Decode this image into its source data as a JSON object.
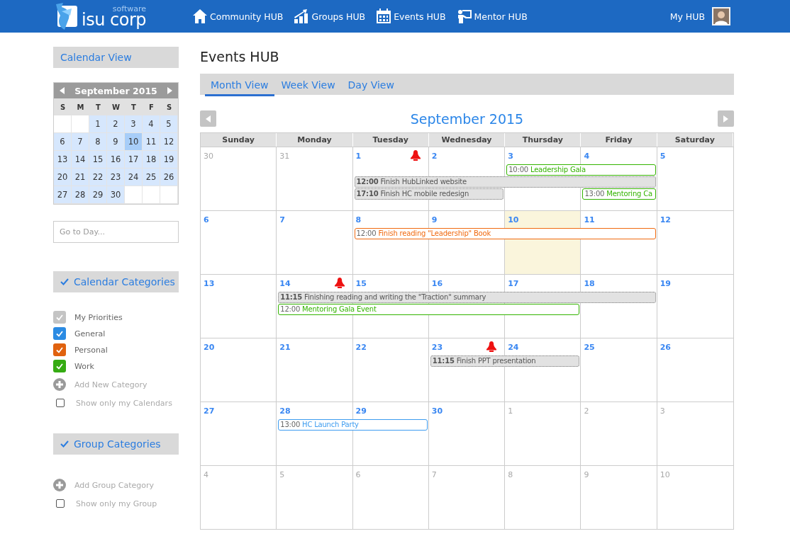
{
  "header": {
    "logo_small": "software",
    "logo_text": "isu corp",
    "nav": [
      {
        "label": "Community HUB"
      },
      {
        "label": "Groups HUB"
      },
      {
        "label": "Events HUB"
      },
      {
        "label": "Mentor HUB"
      }
    ],
    "user": "My HUB"
  },
  "sidebar": {
    "view_title": "Calendar View",
    "mini_calendar": {
      "title": "September 2015",
      "weekdays": [
        "S",
        "M",
        "T",
        "W",
        "T",
        "F",
        "S"
      ],
      "weeks": [
        [
          {
            "label": "1",
            "selected": false
          },
          {
            "label": "2",
            "selected": false
          },
          {
            "label": "3",
            "selected": false
          },
          {
            "label": "4",
            "selected": false
          },
          {
            "label": "5",
            "selected": false
          }
        ],
        [
          {
            "label": "6",
            "selected": false
          },
          {
            "label": "7",
            "selected": false
          },
          {
            "label": "8",
            "selected": false
          },
          {
            "label": "9",
            "selected": false
          },
          {
            "label": "10",
            "selected": true
          },
          {
            "label": "11",
            "selected": false
          },
          {
            "label": "12",
            "selected": false
          }
        ],
        [
          {
            "label": "13",
            "selected": false
          },
          {
            "label": "14",
            "selected": false
          },
          {
            "label": "15",
            "selected": false
          },
          {
            "label": "16",
            "selected": false
          },
          {
            "label": "17",
            "selected": false
          },
          {
            "label": "18",
            "selected": false
          },
          {
            "label": "19",
            "selected": false
          }
        ],
        [
          {
            "label": "20",
            "selected": false
          },
          {
            "label": "21",
            "selected": false
          },
          {
            "label": "22",
            "selected": false
          },
          {
            "label": "23",
            "selected": false
          },
          {
            "label": "24",
            "selected": false
          },
          {
            "label": "25",
            "selected": false
          },
          {
            "label": "26",
            "selected": false
          }
        ],
        [
          {
            "label": "27",
            "selected": false
          },
          {
            "label": "28",
            "selected": false
          },
          {
            "label": "29",
            "selected": false
          },
          {
            "label": "30",
            "selected": false
          }
        ]
      ]
    },
    "goto_placeholder": "Go to Day...",
    "calendar_categories": {
      "title": "Calendar Categories",
      "items": [
        {
          "label": "My Priorities",
          "checked": true,
          "color": "#c4c4c4"
        },
        {
          "label": "General",
          "checked": true,
          "color": "#2b8be3"
        },
        {
          "label": "Personal",
          "checked": true,
          "color": "#e0620f"
        },
        {
          "label": "Work",
          "checked": true,
          "color": "#35ab12"
        }
      ],
      "add_label": "Add New Category",
      "only_mine": {
        "label": "Show only my Calendars",
        "checked": false
      }
    },
    "group_categories": {
      "title": "Group Categories",
      "add_label": "Add Group Category",
      "only_mine": {
        "label": "Show only my Group",
        "checked": false
      }
    }
  },
  "main": {
    "title": "Events HUB",
    "tabs": [
      {
        "label": "Month View",
        "selected": true
      },
      {
        "label": "Week View",
        "selected": false
      },
      {
        "label": "Day View",
        "selected": false
      }
    ],
    "month_title": "September 2015",
    "weekdays": [
      "Sunday",
      "Monday",
      "Tuesday",
      "Wednesday",
      "Thursday",
      "Friday",
      "Saturday"
    ],
    "weeks": [
      {
        "days": [
          {
            "n": "30",
            "other_month": true,
            "today": false,
            "alarm": false
          },
          {
            "n": "31",
            "other_month": true,
            "today": false,
            "alarm": false
          },
          {
            "n": "1",
            "other_month": false,
            "today": false,
            "alarm": true
          },
          {
            "n": "2",
            "other_month": false,
            "today": false,
            "alarm": false
          },
          {
            "n": "3",
            "other_month": false,
            "today": false,
            "alarm": false
          },
          {
            "n": "4",
            "other_month": false,
            "today": false,
            "alarm": false
          },
          {
            "n": "5",
            "other_month": false,
            "today": false,
            "alarm": false
          }
        ],
        "lanes": [
          [
            {
              "kind": "empty"
            },
            {
              "kind": "empty"
            },
            {
              "kind": "empty"
            },
            {
              "kind": "empty"
            },
            {
              "kind": "event",
              "time": "10:00",
              "title": "Leadership Gala",
              "color": "#33b300"
            },
            {
              "kind": "continued"
            }
          ],
          [
            {
              "kind": "empty"
            },
            {
              "kind": "empty"
            },
            {
              "kind": "task",
              "time": "12:00",
              "title": "Finish HubLinked website"
            },
            {
              "kind": "continued"
            },
            {
              "kind": "continued"
            },
            {
              "kind": "continued"
            }
          ],
          [
            {
              "kind": "empty"
            },
            {
              "kind": "empty"
            },
            {
              "kind": "task",
              "time": "17:10",
              "title": "Finish HC mobile redesign"
            },
            {
              "kind": "continued"
            },
            {
              "kind": "empty"
            },
            {
              "kind": "event",
              "time": "13:00",
              "title": "Mentoring Ca",
              "color": "#33b300"
            }
          ]
        ]
      },
      {
        "days": [
          {
            "n": "6",
            "other_month": false,
            "today": false,
            "alarm": false
          },
          {
            "n": "7",
            "other_month": false,
            "today": false,
            "alarm": false
          },
          {
            "n": "8",
            "other_month": false,
            "today": false,
            "alarm": false
          },
          {
            "n": "9",
            "other_month": false,
            "today": false,
            "alarm": false
          },
          {
            "n": "10",
            "other_month": false,
            "today": true,
            "alarm": false
          },
          {
            "n": "11",
            "other_month": false,
            "today": false,
            "alarm": false
          },
          {
            "n": "12",
            "other_month": false,
            "today": false,
            "alarm": false
          }
        ],
        "lanes": [
          [
            {
              "kind": "empty"
            },
            {
              "kind": "empty"
            },
            {
              "kind": "event",
              "time": "12:00",
              "title": "Finish reading \"Leadership\" Book",
              "color": "#f06a10"
            },
            {
              "kind": "continued"
            },
            {
              "kind": "continued"
            },
            {
              "kind": "continued"
            }
          ]
        ]
      },
      {
        "days": [
          {
            "n": "13",
            "other_month": false,
            "today": false,
            "alarm": false
          },
          {
            "n": "14",
            "other_month": false,
            "today": false,
            "alarm": true
          },
          {
            "n": "15",
            "other_month": false,
            "today": false,
            "alarm": false
          },
          {
            "n": "16",
            "other_month": false,
            "today": false,
            "alarm": false
          },
          {
            "n": "17",
            "other_month": false,
            "today": false,
            "alarm": false
          },
          {
            "n": "18",
            "other_month": false,
            "today": false,
            "alarm": false
          },
          {
            "n": "19",
            "other_month": false,
            "today": false,
            "alarm": false
          }
        ],
        "lanes": [
          [
            {
              "kind": "empty"
            },
            {
              "kind": "task",
              "time": "11:15",
              "title": "Finishing reading and writing the \"Traction\" summary"
            },
            {
              "kind": "continued"
            },
            {
              "kind": "continued"
            },
            {
              "kind": "continued"
            },
            {
              "kind": "continued"
            }
          ],
          [
            {
              "kind": "empty"
            },
            {
              "kind": "event",
              "time": "12:00",
              "title": "Mentoring Gala Event",
              "color": "#33b300"
            },
            {
              "kind": "continued"
            },
            {
              "kind": "continued"
            },
            {
              "kind": "continued"
            }
          ]
        ]
      },
      {
        "days": [
          {
            "n": "20",
            "other_month": false,
            "today": false,
            "alarm": false
          },
          {
            "n": "21",
            "other_month": false,
            "today": false,
            "alarm": false
          },
          {
            "n": "22",
            "other_month": false,
            "today": false,
            "alarm": false
          },
          {
            "n": "23",
            "other_month": false,
            "today": false,
            "alarm": true
          },
          {
            "n": "24",
            "other_month": false,
            "today": false,
            "alarm": false
          },
          {
            "n": "25",
            "other_month": false,
            "today": false,
            "alarm": false
          },
          {
            "n": "26",
            "other_month": false,
            "today": false,
            "alarm": false
          }
        ],
        "lanes": [
          [
            {
              "kind": "empty"
            },
            {
              "kind": "empty"
            },
            {
              "kind": "empty"
            },
            {
              "kind": "task",
              "time": "11:15",
              "title": "Finish PPT presentation"
            },
            {
              "kind": "continued"
            }
          ]
        ]
      },
      {
        "days": [
          {
            "n": "27",
            "other_month": false,
            "today": false,
            "alarm": false
          },
          {
            "n": "28",
            "other_month": false,
            "today": false,
            "alarm": false
          },
          {
            "n": "29",
            "other_month": false,
            "today": false,
            "alarm": false
          },
          {
            "n": "30",
            "other_month": false,
            "today": false,
            "alarm": false
          },
          {
            "n": "1",
            "other_month": true,
            "today": false,
            "alarm": false
          },
          {
            "n": "2",
            "other_month": true,
            "today": false,
            "alarm": false
          },
          {
            "n": "3",
            "other_month": true,
            "today": false,
            "alarm": false
          }
        ],
        "lanes": [
          [
            {
              "kind": "empty"
            },
            {
              "kind": "event",
              "time": "13:00",
              "title": "HC Launch Party",
              "color": "#3d9cf0"
            },
            {
              "kind": "continued"
            }
          ]
        ]
      },
      {
        "days": [
          {
            "n": "4",
            "other_month": true,
            "today": false,
            "alarm": false
          },
          {
            "n": "5",
            "other_month": true,
            "today": false,
            "alarm": false
          },
          {
            "n": "6",
            "other_month": true,
            "today": false,
            "alarm": false
          },
          {
            "n": "7",
            "other_month": true,
            "today": false,
            "alarm": false
          },
          {
            "n": "8",
            "other_month": true,
            "today": false,
            "alarm": false
          },
          {
            "n": "9",
            "other_month": true,
            "today": false,
            "alarm": false
          },
          {
            "n": "10",
            "other_month": true,
            "today": false,
            "alarm": false
          }
        ]
      }
    ]
  }
}
